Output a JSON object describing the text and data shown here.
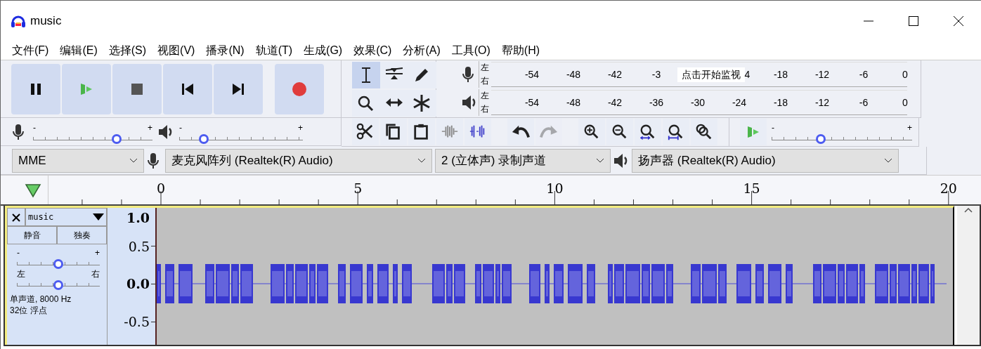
{
  "window": {
    "title": "music"
  },
  "menu": [
    "文件(F)",
    "编辑(E)",
    "选择(S)",
    "视图(V)",
    "播录(N)",
    "轨道(T)",
    "生成(G)",
    "效果(C)",
    "分析(A)",
    "工具(O)",
    "帮助(H)"
  ],
  "transport": [
    {
      "kind": "pause"
    },
    {
      "kind": "play"
    },
    {
      "kind": "stop"
    },
    {
      "kind": "skip-start"
    },
    {
      "kind": "skip-end"
    },
    {
      "kind": "record"
    }
  ],
  "tools": [
    {
      "kind": "select",
      "selected": true
    },
    {
      "kind": "envelope",
      "selected": false
    },
    {
      "kind": "draw",
      "selected": false
    },
    {
      "kind": "zoom",
      "selected": false
    },
    {
      "kind": "time-shift",
      "selected": false
    },
    {
      "kind": "multi",
      "selected": false
    }
  ],
  "meters": [
    {
      "kind": "record",
      "channels": [
        "左",
        "右"
      ],
      "scale": [
        {
          "kind": "tick",
          "label": "-54"
        },
        {
          "kind": "tick",
          "label": "-48"
        },
        {
          "kind": "tick",
          "label": "-42"
        },
        {
          "kind": "tick",
          "label": "-3"
        },
        {
          "kind": "overlay",
          "label": "点击开始监视"
        },
        {
          "kind": "tick",
          "label": "4"
        },
        {
          "kind": "tick",
          "label": "-18"
        },
        {
          "kind": "tick",
          "label": "-12"
        },
        {
          "kind": "tick",
          "label": "-6"
        },
        {
          "kind": "tick",
          "label": "0"
        }
      ]
    },
    {
      "kind": "playback",
      "channels": [
        "左",
        "右"
      ],
      "scale": [
        {
          "kind": "tick",
          "label": "-54"
        },
        {
          "kind": "tick",
          "label": "-48"
        },
        {
          "kind": "tick",
          "label": "-42"
        },
        {
          "kind": "tick",
          "label": "-36"
        },
        {
          "kind": "tick",
          "label": "-30"
        },
        {
          "kind": "tick",
          "label": "-24"
        },
        {
          "kind": "tick",
          "label": "-18"
        },
        {
          "kind": "tick",
          "label": "-12"
        },
        {
          "kind": "tick",
          "label": "-6"
        },
        {
          "kind": "tick",
          "label": "0"
        }
      ]
    }
  ],
  "mixer": [
    {
      "kind": "record",
      "min": "-",
      "max": "+",
      "level": 0.7
    },
    {
      "kind": "playback",
      "min": "-",
      "max": "+",
      "level": 0.2
    }
  ],
  "edit_tools": [
    {
      "kind": "cut",
      "disabled": false
    },
    {
      "kind": "copy",
      "disabled": false
    },
    {
      "kind": "paste",
      "disabled": false
    },
    {
      "kind": "trim",
      "disabled": false
    },
    {
      "kind": "silence",
      "disabled": false
    },
    {
      "kind": "undo",
      "disabled": false
    },
    {
      "kind": "redo",
      "disabled": true
    },
    {
      "kind": "zoom-in",
      "disabled": false
    },
    {
      "kind": "zoom-out",
      "disabled": false
    },
    {
      "kind": "fit-selection",
      "disabled": false
    },
    {
      "kind": "fit-project",
      "disabled": false
    },
    {
      "kind": "zoom-toggle",
      "disabled": false
    }
  ],
  "play_at_speed": {
    "min": "-",
    "max": "+",
    "level": 0.35
  },
  "devices": {
    "host": "MME",
    "input": "麦克风阵列 (Realtek(R) Audio)",
    "channels": "2 (立体声) 录制声道",
    "output": "扬声器 (Realtek(R) Audio)"
  },
  "ruler": [
    "0",
    "5",
    "10",
    "15",
    "20"
  ],
  "track": {
    "name": "music",
    "mute": "静音",
    "solo": "独奏",
    "gain": {
      "min": "-",
      "max": "+",
      "level": 0.5
    },
    "pan": {
      "min": "左",
      "max": "右",
      "level": 0.5
    },
    "info": [
      "单声道, 8000 Hz",
      "32位 浮点"
    ],
    "scale": [
      "1.0",
      "0.5",
      "0.0",
      "-0.5"
    ]
  }
}
